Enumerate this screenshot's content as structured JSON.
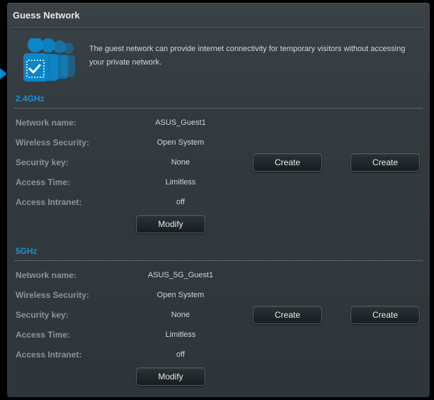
{
  "page": {
    "title": "Guess Network",
    "intro": "The guest network can provide internet connectivity for temporary visitors without accessing your private network."
  },
  "labels": {
    "network_name": "Network name:",
    "wireless_security": "Wireless Security:",
    "security_key": "Security key:",
    "access_time": "Access Time:",
    "access_intranet": "Access Intranet:"
  },
  "buttons": {
    "create": "Create",
    "modify": "Modify"
  },
  "bands": {
    "g24": {
      "title": "2.4GHz",
      "network_name": "ASUS_Guest1",
      "wireless_security": "Open System",
      "security_key": "None",
      "access_time": "Limitless",
      "access_intranet": "off"
    },
    "g5": {
      "title": "5GHz",
      "network_name": "ASUS_5G_Guest1",
      "wireless_security": "Open System",
      "security_key": "None",
      "access_time": "Limitless",
      "access_intranet": "off"
    }
  }
}
